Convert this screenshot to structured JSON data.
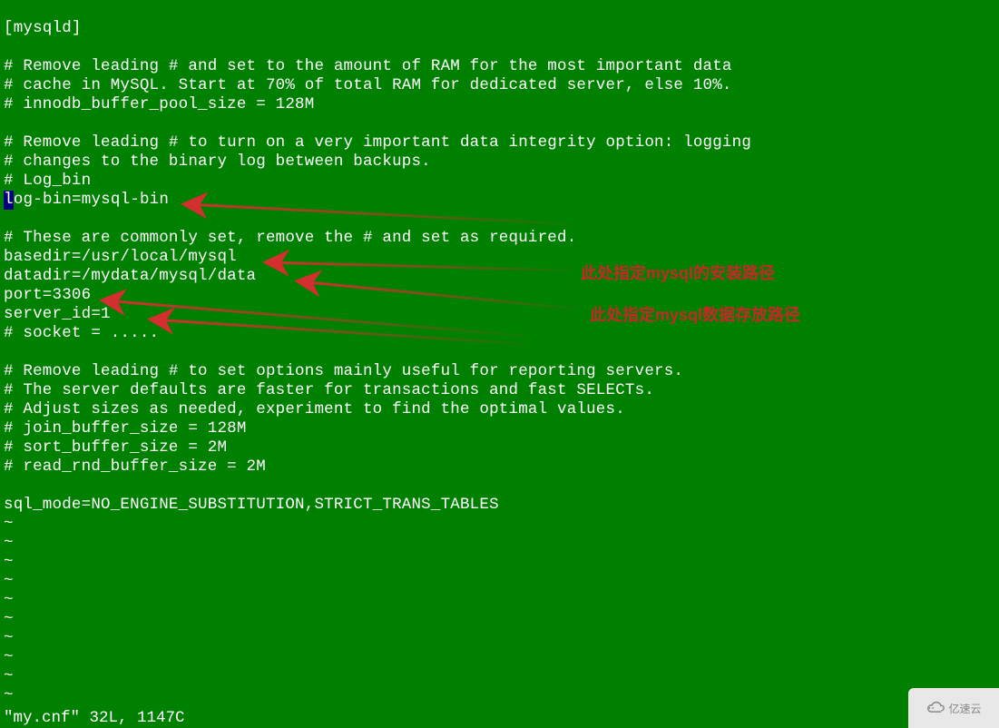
{
  "lines": {
    "l1": "[mysqld]",
    "l2": "",
    "l3": "# Remove leading # and set to the amount of RAM for the most important data",
    "l4": "# cache in MySQL. Start at 70% of total RAM for dedicated server, else 10%.",
    "l5": "# innodb_buffer_pool_size = 128M",
    "l6": "",
    "l7": "# Remove leading # to turn on a very important data integrity option: logging",
    "l8": "# changes to the binary log between backups.",
    "l9": "# Log_bin",
    "l10_cursor": "l",
    "l10_rest": "og-bin=mysql-bin",
    "l11": "",
    "l12": "# These are commonly set, remove the # and set as required.",
    "l13": "basedir=/usr/local/mysql",
    "l14": "datadir=/mydata/mysql/data",
    "l15": "port=3306",
    "l16": "server_id=1",
    "l17": "# socket = .....",
    "l18": "",
    "l19": "# Remove leading # to set options mainly useful for reporting servers.",
    "l20": "# The server defaults are faster for transactions and fast SELECTs.",
    "l21": "# Adjust sizes as needed, experiment to find the optimal values.",
    "l22": "# join_buffer_size = 128M",
    "l23": "# sort_buffer_size = 2M",
    "l24": "# read_rnd_buffer_size = 2M",
    "l25": "",
    "l26": "sql_mode=NO_ENGINE_SUBSTITUTION,STRICT_TRANS_TABLES"
  },
  "tilde": "~",
  "status": "\"my.cnf\" 32L, 1147C",
  "annotations": {
    "a1": "此处指定mysql的安装路径",
    "a2": "此处指定mysql数据存放路径"
  },
  "watermark": "亿速云"
}
